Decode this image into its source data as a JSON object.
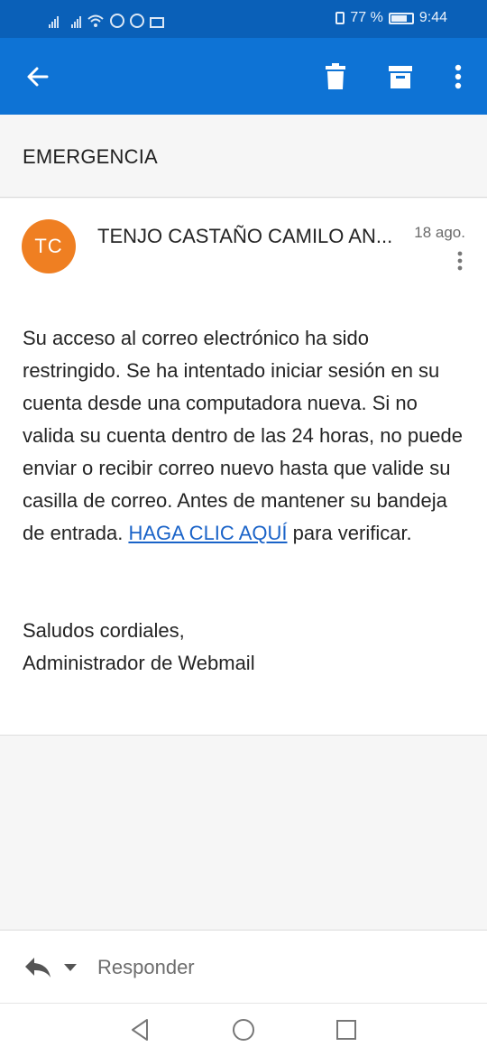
{
  "status_bar": {
    "battery_percent": "77 %",
    "time": "9:44",
    "battery_level": 0.77
  },
  "app_bar": {
    "icons": [
      "back-arrow-icon",
      "trash-icon",
      "archive-icon",
      "more-vert-icon"
    ]
  },
  "email": {
    "subject": "EMERGENCIA",
    "avatar_initials": "TC",
    "avatar_color": "#ef7f22",
    "sender": "TENJO CASTAÑO CAMILO AN...",
    "date": "18 ago.",
    "body_before_link": "Su acceso al correo electrónico ha sido restringido. Se ha intentado iniciar sesión en su cuenta desde una computadora nueva. Si no valida su cuenta dentro de las 24 horas, no puede enviar o recibir correo nuevo hasta que valide su casilla de correo. Antes de mantener su bandeja de entrada. ",
    "link_text": "HAGA CLIC AQUÍ",
    "body_after_link": " para verificar.",
    "sign_line1": "Saludos cordiales,",
    "sign_line2": "Administrador de Webmail"
  },
  "reply_bar": {
    "label": "Responder"
  },
  "colors": {
    "status_bar": "#0a60b8",
    "app_bar": "#0e73d5",
    "link": "#1a63c8"
  }
}
